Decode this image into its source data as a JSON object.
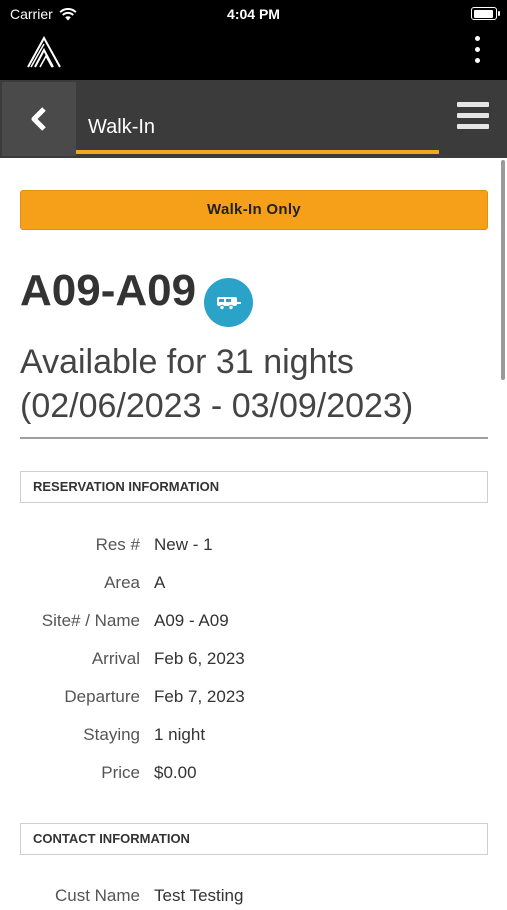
{
  "status_bar": {
    "carrier": "Carrier",
    "time": "4:04 PM"
  },
  "nav": {
    "title": "Walk-In"
  },
  "walkin_button": "Walk-In Only",
  "site": {
    "name": "A09-A09",
    "availability_line1": "Available for 31 nights",
    "availability_line2": "(02/06/2023 - 03/09/2023)"
  },
  "reservation": {
    "header": "RESERVATION INFORMATION",
    "rows": [
      {
        "label": "Res #",
        "value": "New - 1"
      },
      {
        "label": "Area",
        "value": "A"
      },
      {
        "label": "Site# / Name",
        "value": "A09 - A09"
      },
      {
        "label": "Arrival",
        "value": "Feb 6, 2023"
      },
      {
        "label": "Departure",
        "value": "Feb 7, 2023"
      },
      {
        "label": "Staying",
        "value": "1 night"
      },
      {
        "label": "Price",
        "value": "$0.00"
      }
    ]
  },
  "contact": {
    "header": "CONTACT INFORMATION",
    "rows": [
      {
        "label": "Cust Name",
        "value": "Test Testing"
      }
    ]
  },
  "colors": {
    "accent": "#f6a01a",
    "badge": "#2ba3c9",
    "nav_bg": "#3b3b3b"
  },
  "icons": [
    "wifi-icon",
    "battery-icon",
    "logo-icon",
    "kebab-menu-icon",
    "back-icon",
    "hamburger-menu-icon",
    "rv-trailer-icon"
  ]
}
